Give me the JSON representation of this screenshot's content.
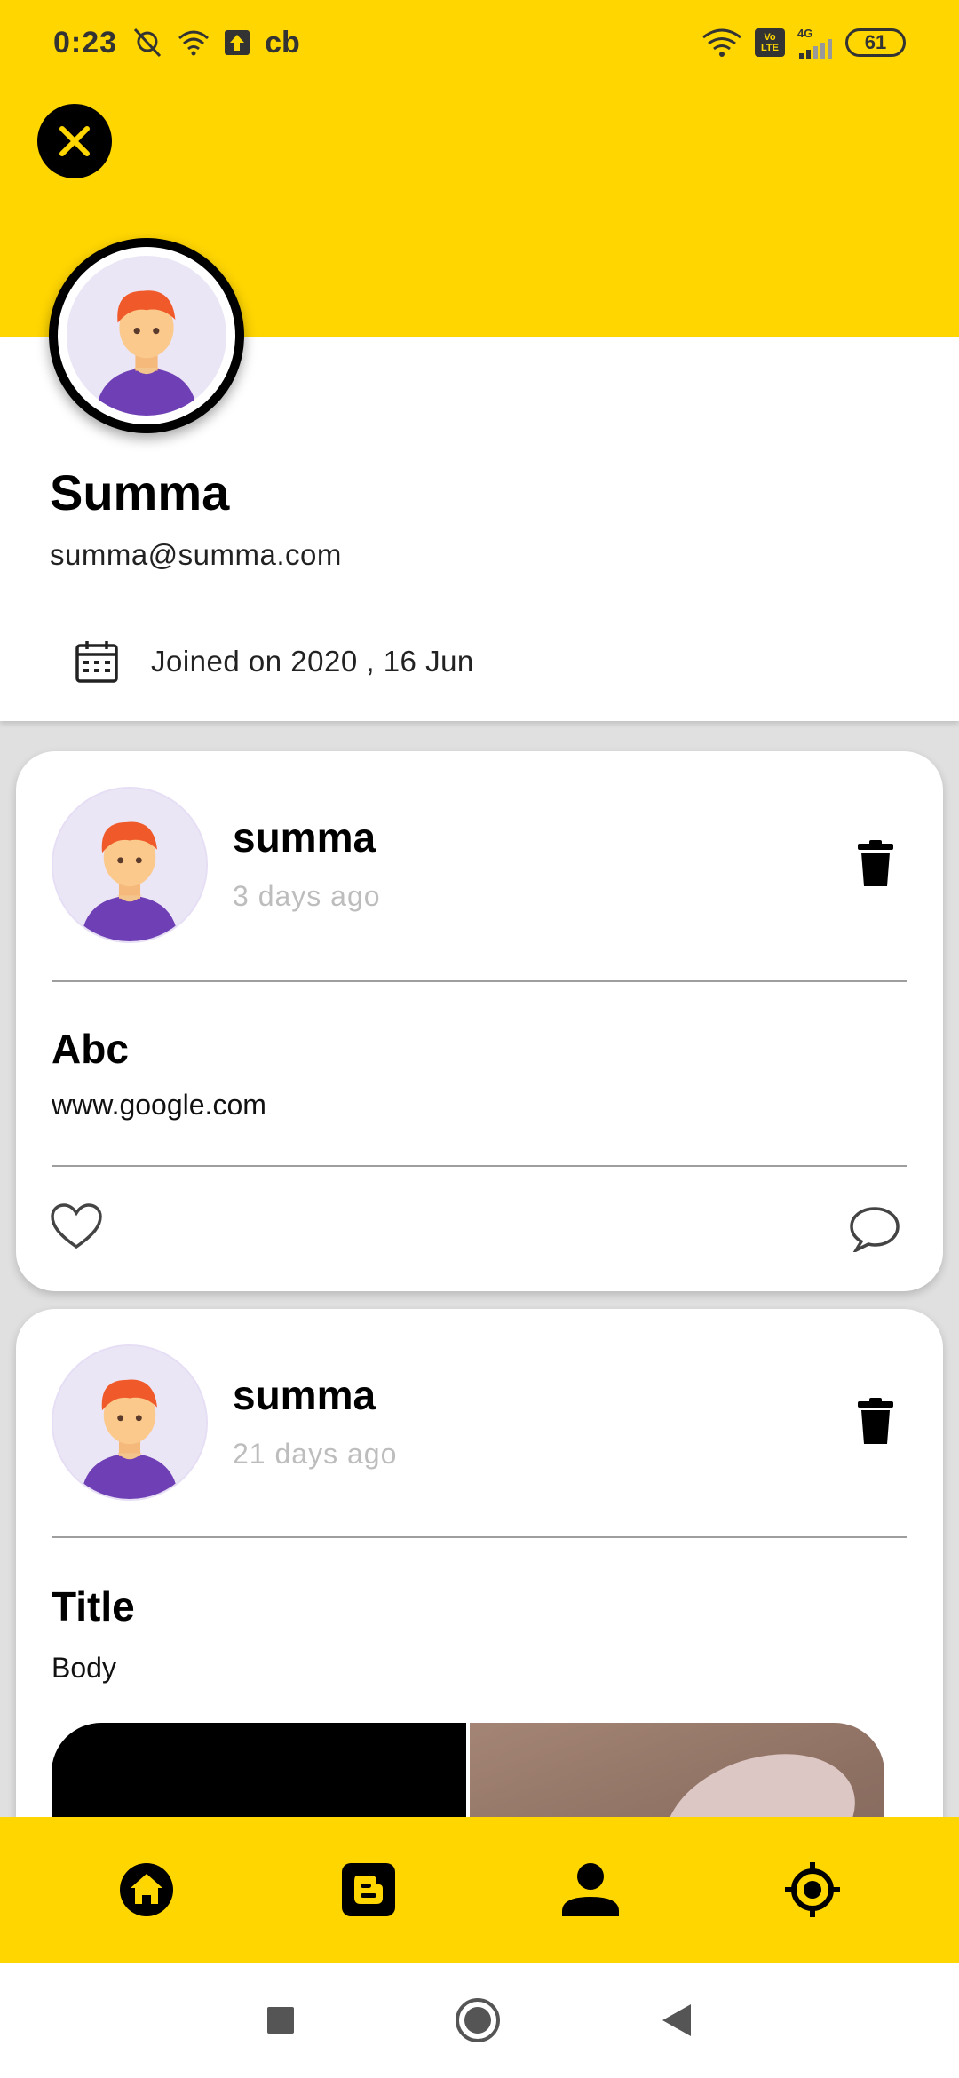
{
  "status_bar": {
    "time": "0:23",
    "carrier_badge": "cb",
    "network_type": "4G",
    "volte_label": "Vo LTE",
    "battery": "61"
  },
  "profile": {
    "name": "Summa",
    "email": "summa@summa.com",
    "joined": "Joined on 2020 , 16 Jun"
  },
  "posts": [
    {
      "user": "summa",
      "time": "3 days ago",
      "title": "Abc",
      "body": "www.google.com"
    },
    {
      "user": "summa",
      "time": "21 days ago",
      "title": "Title",
      "body": "Body"
    }
  ],
  "bottom_nav": [
    {
      "icon": "home-icon"
    },
    {
      "icon": "blogger-icon"
    },
    {
      "icon": "person-icon"
    },
    {
      "icon": "location-target-icon"
    }
  ],
  "colors": {
    "accent": "#FFD600",
    "text_muted": "#BDBDBD"
  }
}
